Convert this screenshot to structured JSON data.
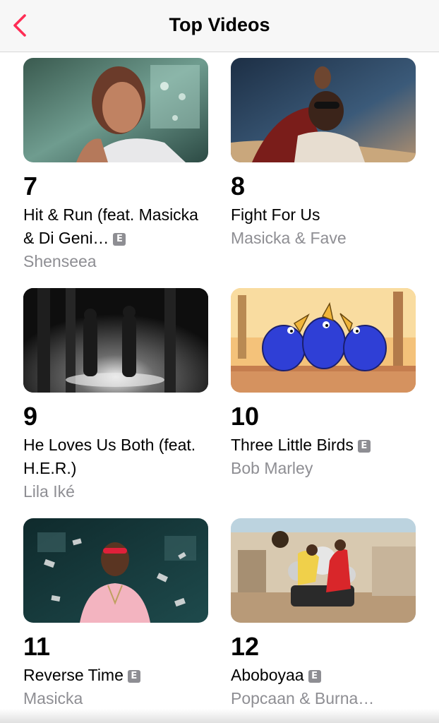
{
  "nav": {
    "title": "Top Videos"
  },
  "videos": [
    {
      "rank": "7",
      "title": "Hit & Run (feat. Masicka & Di Geni…",
      "explicit": true,
      "artist": "Shenseea"
    },
    {
      "rank": "8",
      "title": "Fight For Us",
      "explicit": false,
      "artist": "Masicka & Fave"
    },
    {
      "rank": "9",
      "title": "He Loves Us Both (feat. H.E.R.)",
      "explicit": false,
      "artist": "Lila Iké"
    },
    {
      "rank": "10",
      "title": "Three Little Birds",
      "explicit": true,
      "artist": "Bob Marley"
    },
    {
      "rank": "11",
      "title": "Reverse Time",
      "explicit": true,
      "artist": "Masicka"
    },
    {
      "rank": "12",
      "title": "Aboboyaa",
      "explicit": true,
      "artist": "Popcaan & Burna…"
    }
  ],
  "explicit_badge": "E",
  "colors": {
    "accent": "#ff2d55",
    "secondary_text": "#8e8e93"
  },
  "icons": {
    "back": "chevron-left-icon"
  }
}
